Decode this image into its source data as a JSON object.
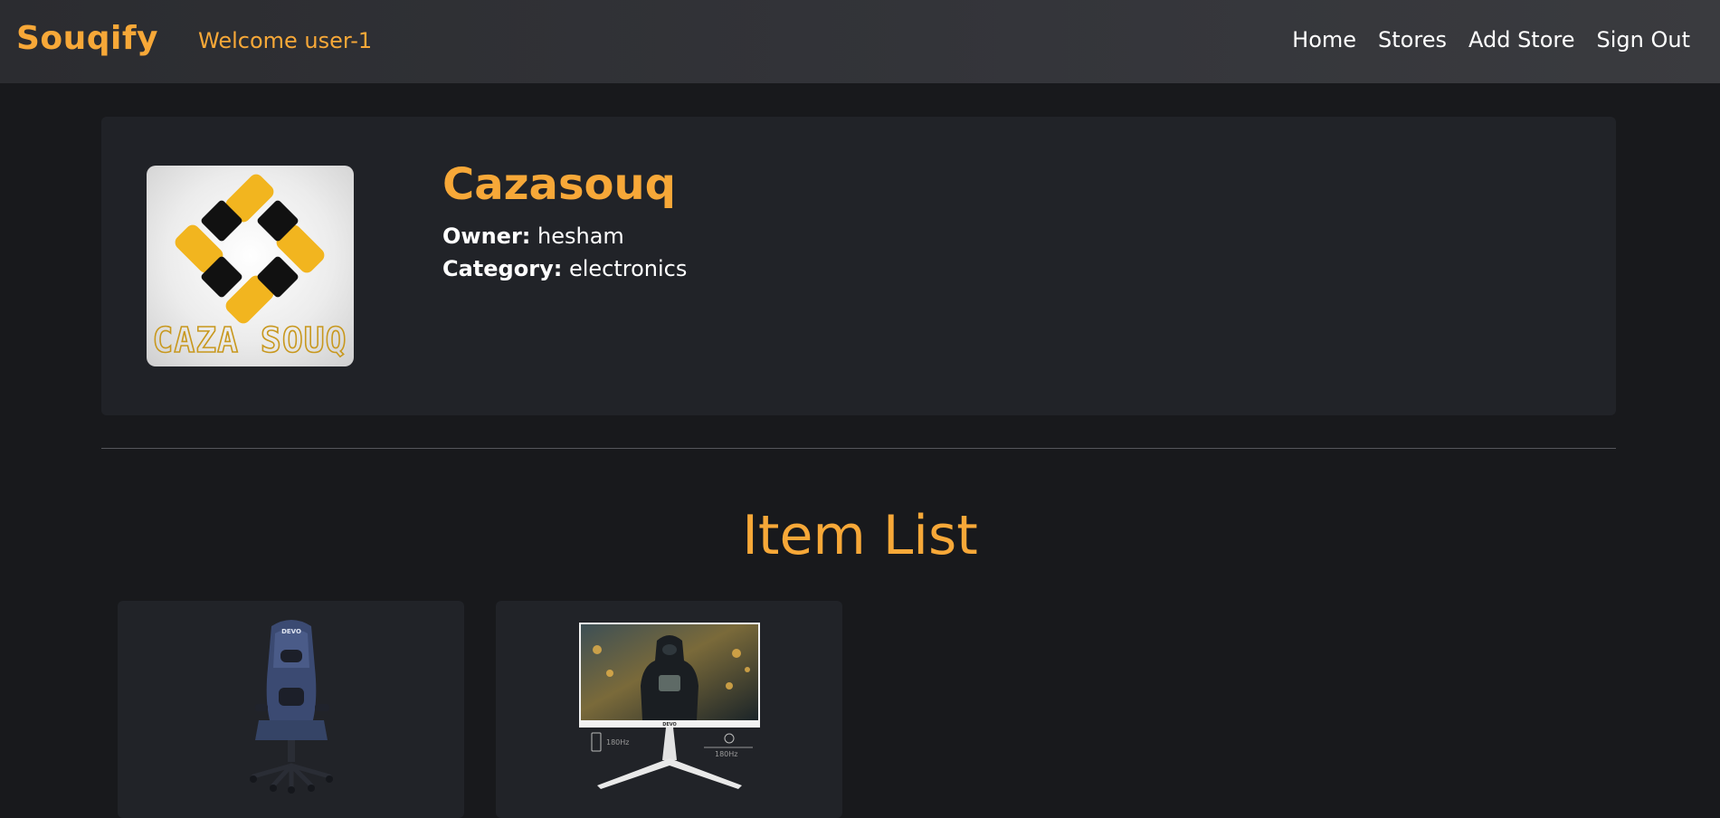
{
  "navbar": {
    "brand": "Souqify",
    "welcome": "Welcome user-1",
    "links": [
      "Home",
      "Stores",
      "Add Store",
      "Sign Out"
    ]
  },
  "store": {
    "name": "Cazasouq",
    "owner_label": "Owner:",
    "owner": "hesham",
    "category_label": "Category:",
    "category": "electronics",
    "logo_text": "CAZA SOUQ"
  },
  "items_section": {
    "title": "Item List"
  },
  "items": [
    {
      "image_name": "gaming-chair-image",
      "brand_text": "DEVO"
    },
    {
      "image_name": "gaming-monitor-image",
      "brand_text": "DEVO",
      "spec_left": "180Hz",
      "spec_right": "180Hz"
    }
  ],
  "colors": {
    "accent": "#f7a838",
    "background": "#18191c",
    "card": "#212328",
    "navbar": "#34353a"
  }
}
